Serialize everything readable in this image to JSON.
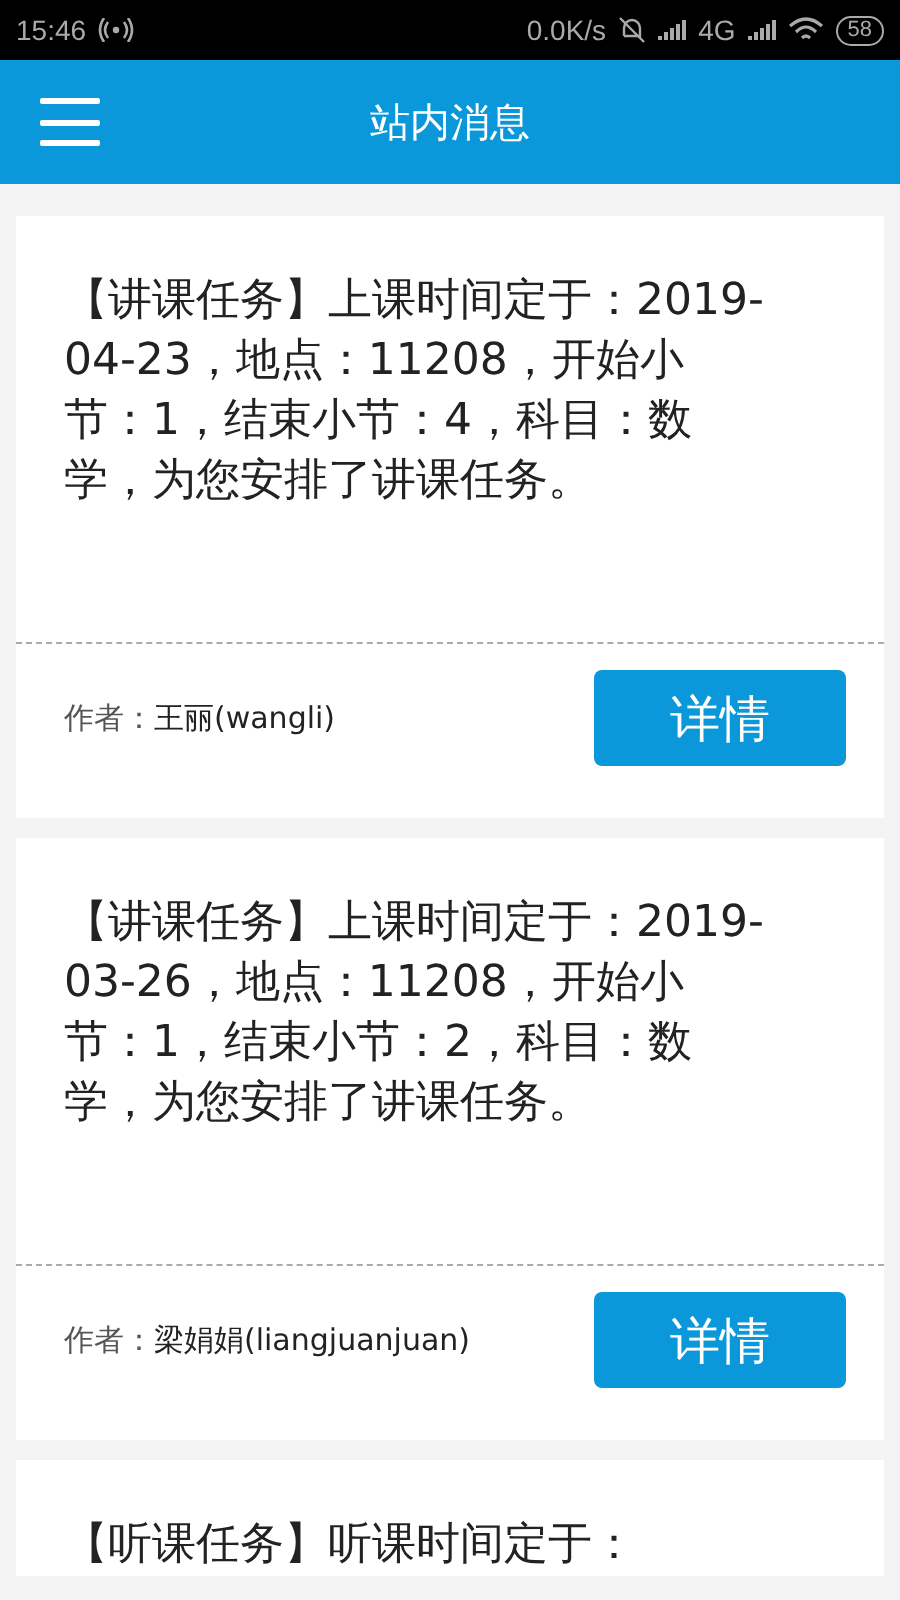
{
  "status_bar": {
    "time": "15:46",
    "speed": "0.0K/s",
    "network": "4G",
    "battery": "58"
  },
  "app_bar": {
    "title": "站内消息"
  },
  "messages": [
    {
      "text": "【讲课任务】上课时间定于：2019-04-23，地点：11208，开始小节：1，结束小节：4，科目：数学，为您安排了讲课任务。",
      "author_label": "作者：",
      "author": "王丽(wangli)",
      "button": "详情"
    },
    {
      "text": "【讲课任务】上课时间定于：2019-03-26，地点：11208，开始小节：1，结束小节：2，科目：数学，为您安排了讲课任务。",
      "author_label": "作者：",
      "author": "梁娟娟(liangjuanjuan)",
      "button": "详情"
    },
    {
      "text": "【听课任务】听课时间定于："
    }
  ]
}
